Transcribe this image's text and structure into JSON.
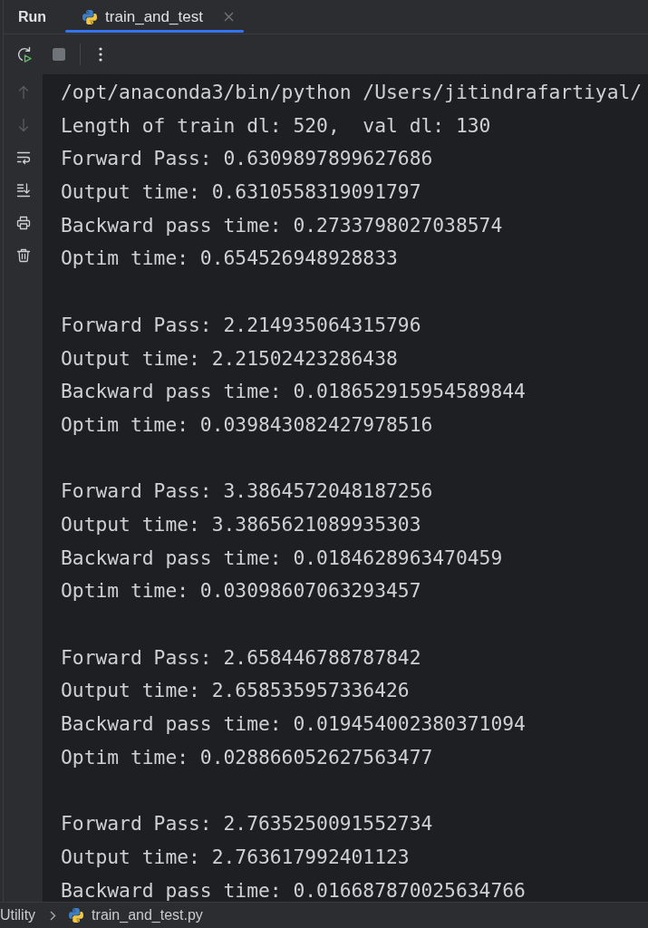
{
  "tool_window": {
    "title": "Run"
  },
  "tabs": [
    {
      "label": "train_and_test",
      "selected": true,
      "closable": true
    }
  ],
  "toolbar": [
    {
      "kind": "rerun",
      "disabled": false
    },
    {
      "kind": "stop",
      "disabled": true
    },
    {
      "kind": "more",
      "disabled": false
    }
  ],
  "gutter": [
    {
      "kind": "up",
      "disabled": true
    },
    {
      "kind": "down",
      "disabled": true
    },
    {
      "kind": "soft-wrap",
      "disabled": false
    },
    {
      "kind": "scroll-end",
      "disabled": false
    },
    {
      "kind": "print",
      "disabled": false
    },
    {
      "kind": "trash",
      "disabled": false
    }
  ],
  "console": {
    "groups": [
      [
        "/opt/anaconda3/bin/python /Users/jitindrafartiyal/",
        "Length of train dl: 520,  val dl: 130",
        "Forward Pass: 0.6309897899627686",
        "Output time: 0.6310558319091797",
        "Backward pass time: 0.2733798027038574",
        "Optim time: 0.654526948928833"
      ],
      [
        "Forward Pass: 2.214935064315796",
        "Output time: 2.21502423286438",
        "Backward pass time: 0.018652915954589844",
        "Optim time: 0.039843082427978516"
      ],
      [
        "Forward Pass: 3.3864572048187256",
        "Output time: 3.3865621089935303",
        "Backward pass time: 0.0184628963470459",
        "Optim time: 0.03098607063293457"
      ],
      [
        "Forward Pass: 2.658446788787842",
        "Output time: 2.658535957336426",
        "Backward pass time: 0.019454002380371094",
        "Optim time: 0.028866052627563477"
      ],
      [
        "Forward Pass: 2.7635250091552734",
        "Output time: 2.763617992401123",
        "Backward pass time: 0.016687870025634766"
      ]
    ]
  },
  "breadcrumbs": [
    {
      "label": "Utility",
      "kind": "folder"
    },
    {
      "label": "train_and_test.py",
      "kind": "python-file"
    }
  ]
}
